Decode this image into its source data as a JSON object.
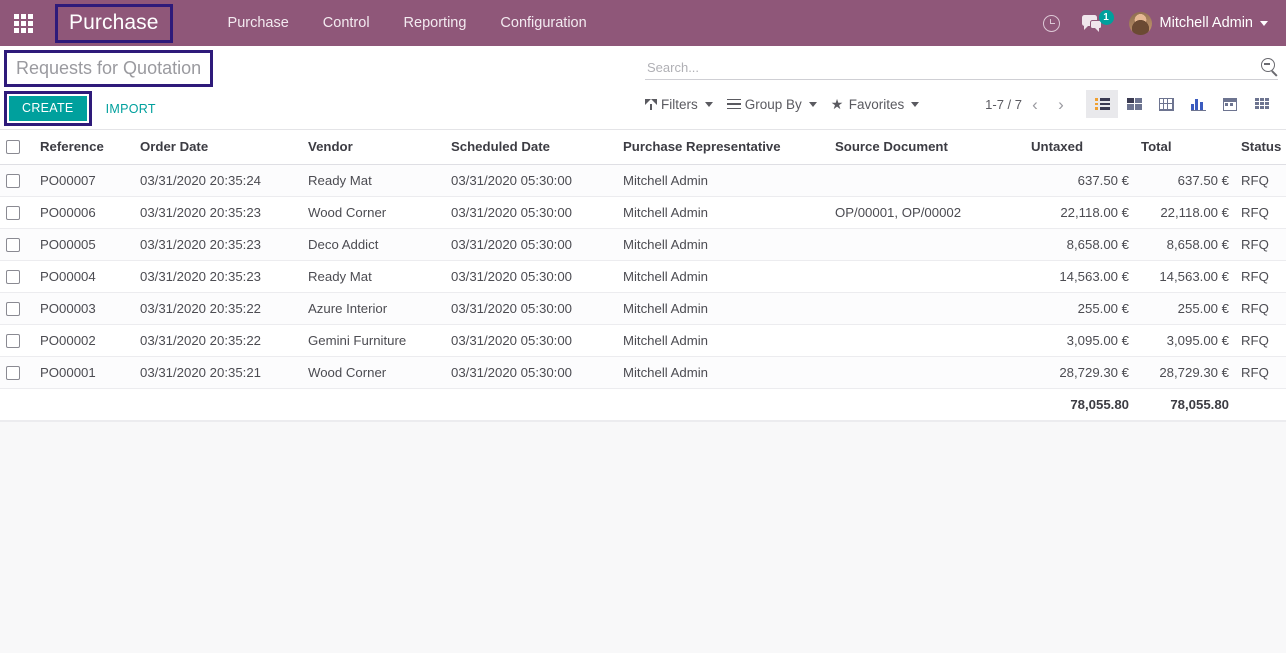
{
  "navbar": {
    "apps_icon": "apps-grid-icon",
    "brand": "Purchase",
    "menu": [
      {
        "label": "Purchase"
      },
      {
        "label": "Control"
      },
      {
        "label": "Reporting"
      },
      {
        "label": "Configuration"
      }
    ],
    "clock_icon": "clock-icon",
    "messages_icon": "messages-icon",
    "messages_count": "1",
    "user_name": "Mitchell Admin",
    "avatar_icon": "avatar",
    "caret_icon": "chevron-down-icon",
    "background_color": "#8f5779",
    "badge_color": "#00a09d"
  },
  "control_panel": {
    "breadcrumb_title": "Requests for Quotation",
    "create_label": "CREATE",
    "import_label": "IMPORT",
    "create_color": "#00a09d",
    "highlight_color": "#2e1a7a",
    "search": {
      "value": "",
      "placeholder": "Search...",
      "icon": "search-icon"
    },
    "filters": [
      {
        "label": "Filters",
        "icon": "funnel-icon"
      },
      {
        "label": "Group By",
        "icon": "bars-icon"
      },
      {
        "label": "Favorites",
        "icon": "star-icon"
      }
    ],
    "pager": {
      "range": "1-7 / 7",
      "prev_icon": "chevron-left-icon",
      "next_icon": "chevron-right-icon"
    },
    "views": [
      {
        "name": "list",
        "icon": "list-view-icon",
        "active": true
      },
      {
        "name": "kanban",
        "icon": "kanban-view-icon",
        "active": false
      },
      {
        "name": "pivot",
        "icon": "pivot-view-icon",
        "active": false
      },
      {
        "name": "graph",
        "icon": "graph-view-icon",
        "active": false
      },
      {
        "name": "calendar",
        "icon": "calendar-view-icon",
        "active": false
      },
      {
        "name": "activity",
        "icon": "activity-view-icon",
        "active": false
      }
    ]
  },
  "list": {
    "columns": [
      "Reference",
      "Order Date",
      "Vendor",
      "Scheduled Date",
      "Purchase Representative",
      "Source Document",
      "Untaxed",
      "Total",
      "Status"
    ],
    "rows": [
      {
        "reference": "PO00007",
        "order_date": "03/31/2020 20:35:24",
        "vendor": "Ready Mat",
        "scheduled_date": "03/31/2020 05:30:00",
        "representative": "Mitchell Admin",
        "source_document": "",
        "untaxed": "637.50 €",
        "total": "637.50 €",
        "status": "RFQ"
      },
      {
        "reference": "PO00006",
        "order_date": "03/31/2020 20:35:23",
        "vendor": "Wood Corner",
        "scheduled_date": "03/31/2020 05:30:00",
        "representative": "Mitchell Admin",
        "source_document": "OP/00001, OP/00002",
        "untaxed": "22,118.00 €",
        "total": "22,118.00 €",
        "status": "RFQ"
      },
      {
        "reference": "PO00005",
        "order_date": "03/31/2020 20:35:23",
        "vendor": "Deco Addict",
        "scheduled_date": "03/31/2020 05:30:00",
        "representative": "Mitchell Admin",
        "source_document": "",
        "untaxed": "8,658.00 €",
        "total": "8,658.00 €",
        "status": "RFQ"
      },
      {
        "reference": "PO00004",
        "order_date": "03/31/2020 20:35:23",
        "vendor": "Ready Mat",
        "scheduled_date": "03/31/2020 05:30:00",
        "representative": "Mitchell Admin",
        "source_document": "",
        "untaxed": "14,563.00 €",
        "total": "14,563.00 €",
        "status": "RFQ"
      },
      {
        "reference": "PO00003",
        "order_date": "03/31/2020 20:35:22",
        "vendor": "Azure Interior",
        "scheduled_date": "03/31/2020 05:30:00",
        "representative": "Mitchell Admin",
        "source_document": "",
        "untaxed": "255.00 €",
        "total": "255.00 €",
        "status": "RFQ"
      },
      {
        "reference": "PO00002",
        "order_date": "03/31/2020 20:35:22",
        "vendor": "Gemini Furniture",
        "scheduled_date": "03/31/2020 05:30:00",
        "representative": "Mitchell Admin",
        "source_document": "",
        "untaxed": "3,095.00 €",
        "total": "3,095.00 €",
        "status": "RFQ"
      },
      {
        "reference": "PO00001",
        "order_date": "03/31/2020 20:35:21",
        "vendor": "Wood Corner",
        "scheduled_date": "03/31/2020 05:30:00",
        "representative": "Mitchell Admin",
        "source_document": "",
        "untaxed": "28,729.30 €",
        "total": "28,729.30 €",
        "status": "RFQ"
      }
    ],
    "totals": {
      "untaxed": "78,055.80",
      "total": "78,055.80"
    }
  }
}
